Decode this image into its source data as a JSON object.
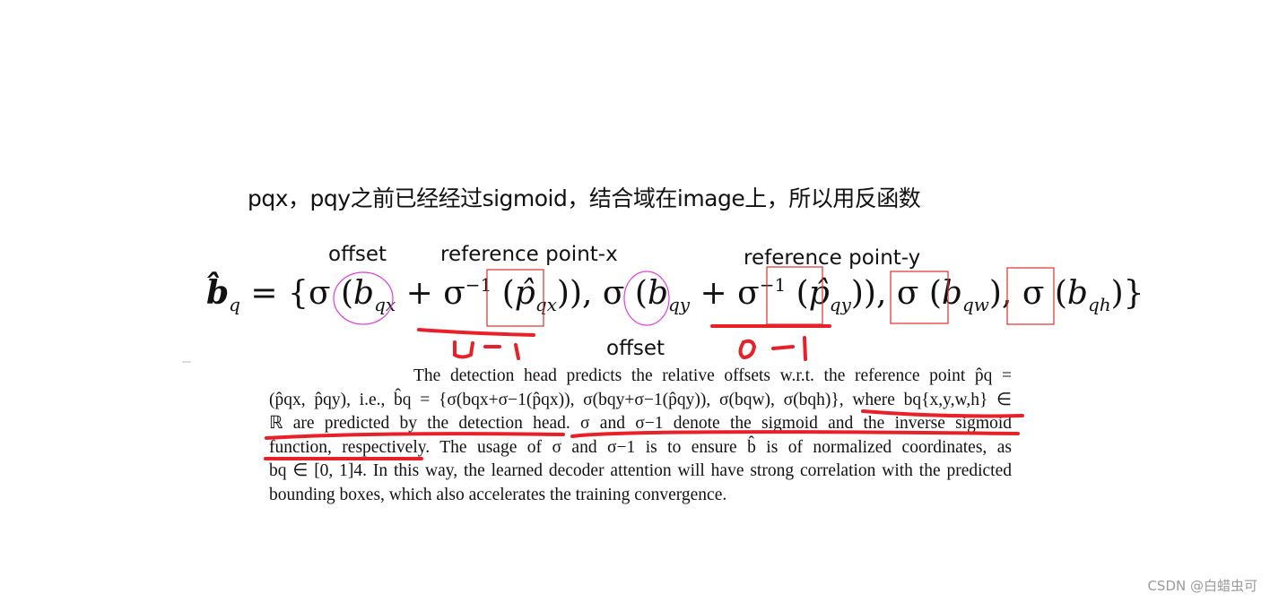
{
  "annotation_note": "pqx，pqy之前已经经过sigmoid，结合域在image上，所以用反函数",
  "labels": {
    "offset_1": "offset",
    "reference_x": "reference point-x",
    "offset_2": "offset",
    "reference_y": "reference point-y"
  },
  "handwritten": {
    "range_x": "0-1",
    "range_y": "0-1"
  },
  "formula": {
    "lhs": "b̂",
    "lhs_sub": "q",
    "equals": " = {σ (",
    "term1": "b",
    "term1_sub": "qx",
    "plus1": " + σ",
    "inv1": "−1",
    "paren_open1": " (",
    "ref1": "p̂",
    "ref1_sub": "qx",
    "close1": ")), σ (",
    "term2": "b",
    "term2_sub": "qy",
    "plus2": " + σ",
    "inv2": "−1",
    "paren_open2": " (",
    "ref2": "p̂",
    "ref2_sub": "qy",
    "close2": ")), σ (",
    "term3": "b",
    "term3_sub": "qw",
    "close3": "), σ (",
    "term4": "b",
    "term4_sub": "qh",
    "close4": ")}"
  },
  "paragraph": {
    "lines": [
      "The detection head predicts the relative offsets w.r.t. the reference point p̂q =",
      "(p̂qx, p̂qy), i.e., b̂q = {σ(bqx+σ−1(p̂qx)), σ(bqy+σ−1(p̂qy)), σ(bqw), σ(bqh)}, where bq{x,y,w,h} ∈",
      "ℝ are predicted by the detection head. σ and σ−1 denote the sigmoid and the inverse sigmoid",
      "function, respectively. The usage of σ and σ−1 is to ensure b̂ is of normalized coordinates, as",
      "bq ∈ [0, 1]4. In this way, the learned decoder attention will have strong correlation with the predicted",
      "bounding boxes, which also accelerates the training convergence."
    ]
  },
  "watermark": "CSDN @白蜡虫可",
  "colors": {
    "red_annotation": "#e8202a",
    "magenta_circle": "#e040e0",
    "box_red": "#e03030"
  }
}
